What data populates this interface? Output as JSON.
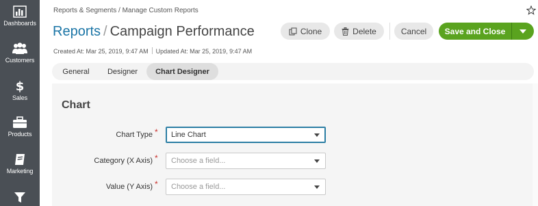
{
  "sidebar": {
    "items": [
      {
        "label": "Dashboards",
        "icon": "bar-chart-icon"
      },
      {
        "label": "Customers",
        "icon": "users-icon"
      },
      {
        "label": "Sales",
        "icon": "dollar-icon"
      },
      {
        "label": "Products",
        "icon": "briefcase-icon"
      },
      {
        "label": "Marketing",
        "icon": "book-icon"
      },
      {
        "label": "",
        "icon": "filter-icon"
      }
    ]
  },
  "header": {
    "breadcrumb": "Reports & Segments / Manage Custom Reports",
    "title_lead": "Reports",
    "title_sep": "/",
    "title_main": "Campaign Performance",
    "created": "Created At: Mar 25, 2019, 9:47 AM",
    "updated": "Updated At: Mar 25, 2019, 9:47 AM"
  },
  "toolbar": {
    "clone_label": "Clone",
    "delete_label": "Delete",
    "cancel_label": "Cancel",
    "save_label": "Save and Close"
  },
  "tabs": [
    {
      "label": "General"
    },
    {
      "label": "Designer"
    },
    {
      "label": "Chart Designer",
      "active": true
    }
  ],
  "content": {
    "section_title": "Chart",
    "fields": [
      {
        "label": "Chart Type",
        "required": "*",
        "value": "Line Chart",
        "placeholder": ""
      },
      {
        "label": "Category (X Axis)",
        "required": "*",
        "value": "",
        "placeholder": "Choose a field..."
      },
      {
        "label": "Value (Y Axis)",
        "required": "*",
        "value": "",
        "placeholder": "Choose a field..."
      }
    ]
  },
  "colors": {
    "sidebar_bg": "#4a4f55",
    "accent_link": "#1b75a6",
    "primary_button": "#5aa31f",
    "required_mark": "#c9302c"
  }
}
